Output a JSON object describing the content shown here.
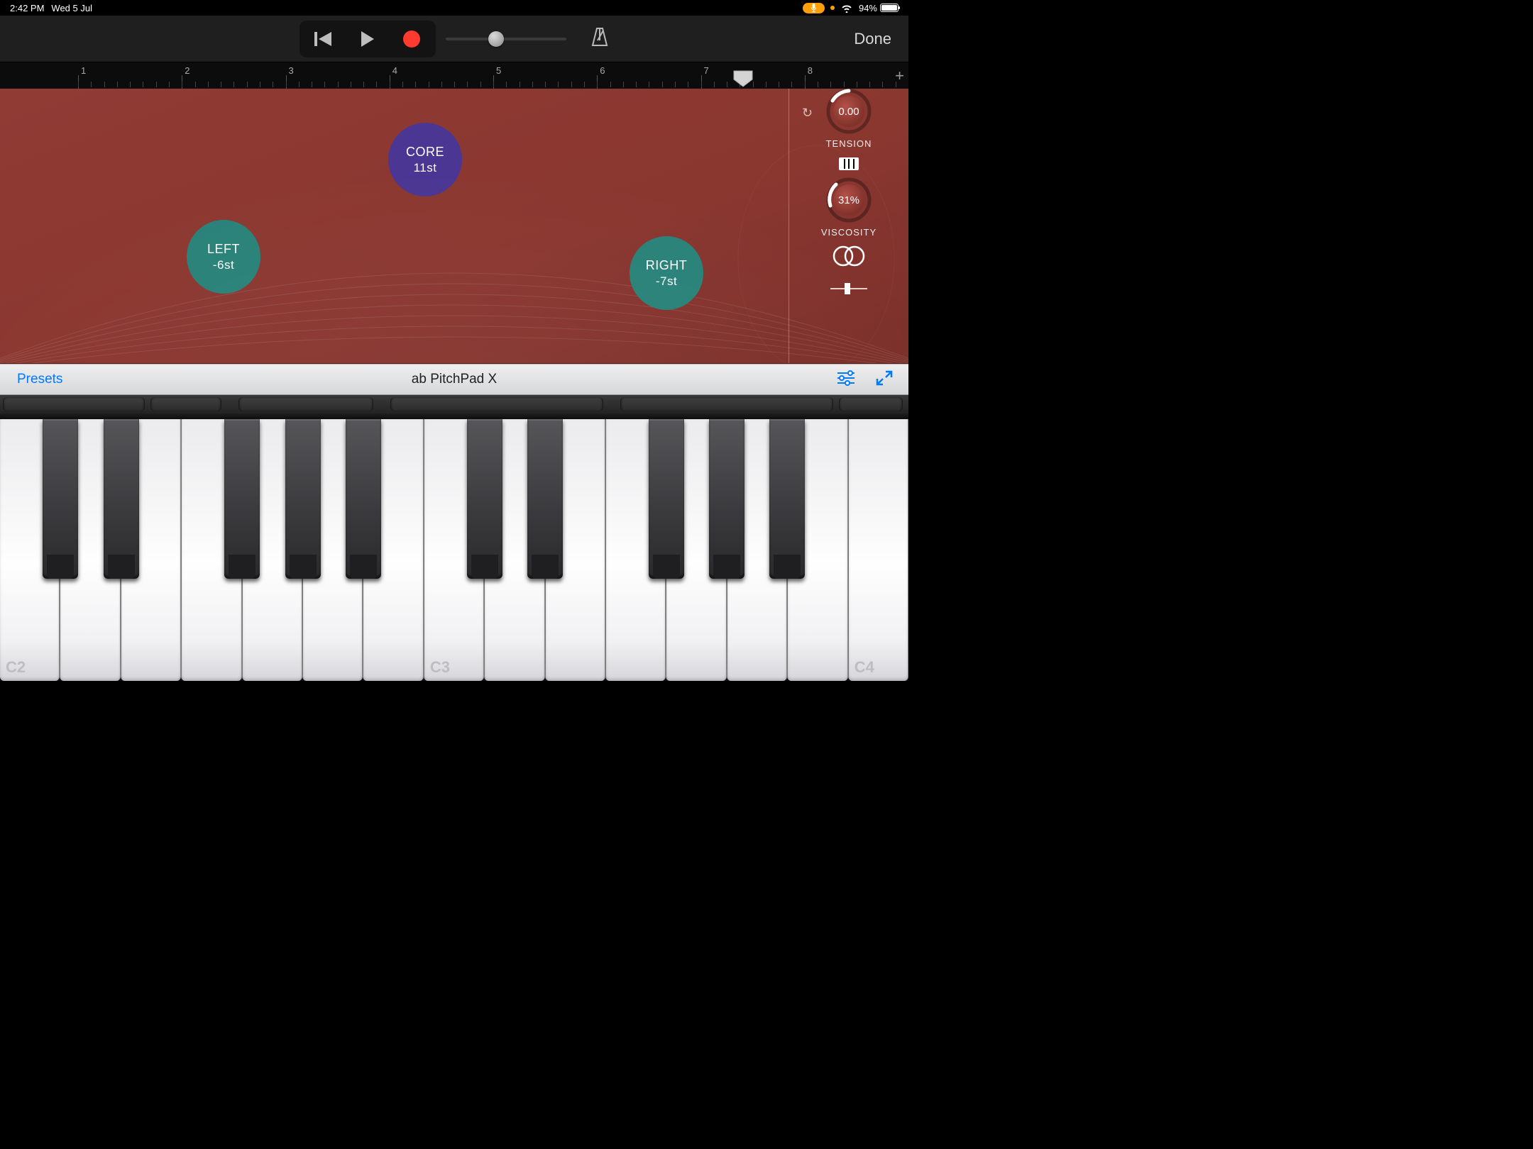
{
  "status": {
    "time": "2:42 PM",
    "date": "Wed 5 Jul",
    "battery": "94%"
  },
  "transport": {
    "done": "Done"
  },
  "ruler": {
    "bars": [
      "1",
      "2",
      "3",
      "4",
      "5",
      "6",
      "7",
      "8"
    ],
    "playhead_bar": 7.1
  },
  "pad": {
    "core": {
      "label": "CORE",
      "value": "11st"
    },
    "left": {
      "label": "LEFT",
      "value": "-6st"
    },
    "right": {
      "label": "RIGHT",
      "value": "-7st"
    }
  },
  "controls": {
    "tension": {
      "label": "TENSION",
      "value": "0.00"
    },
    "viscosity": {
      "label": "VISCOSITY",
      "value": "31%"
    }
  },
  "preset_bar": {
    "presets": "Presets",
    "name": "ab PitchPad X"
  },
  "keyboard": {
    "labels": [
      "C2",
      "C3",
      "C4"
    ]
  }
}
